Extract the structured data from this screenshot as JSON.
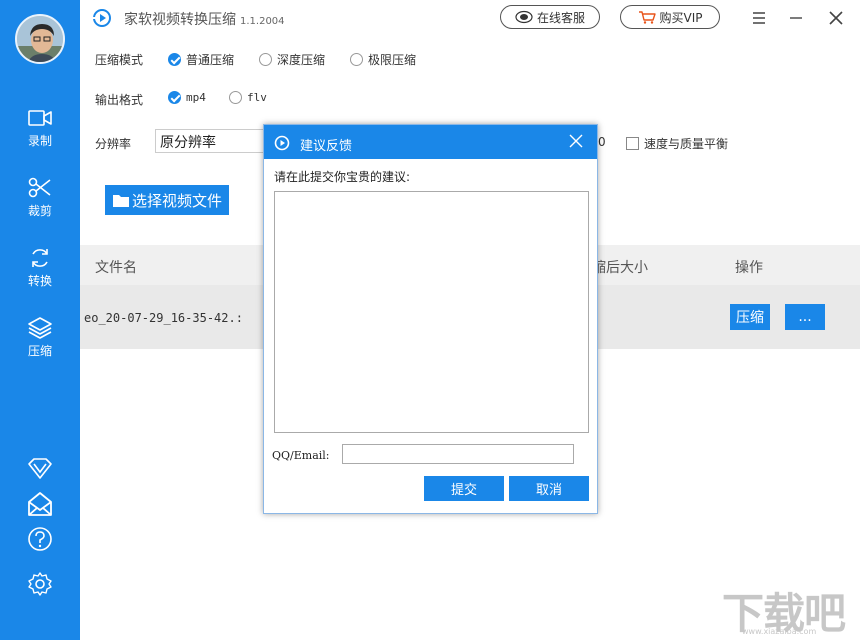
{
  "app": {
    "title": "家软视频转换压缩",
    "version": "1.1.2004"
  },
  "header": {
    "online_service": "在线客服",
    "buy_vip": "购买VIP"
  },
  "sidebar": {
    "items": [
      {
        "label": "录制",
        "icon": "video-camera-icon"
      },
      {
        "label": "裁剪",
        "icon": "scissors-icon"
      },
      {
        "label": "转换",
        "icon": "refresh-icon"
      },
      {
        "label": "压缩",
        "icon": "layers-icon"
      }
    ],
    "bottom_icons": [
      "diamond-icon",
      "mail-icon",
      "help-icon",
      "gear-icon"
    ]
  },
  "settings": {
    "compress_mode_label": "压缩模式",
    "compress_modes": [
      {
        "label": "普通压缩",
        "checked": true
      },
      {
        "label": "深度压缩",
        "checked": false
      },
      {
        "label": "极限压缩",
        "checked": false
      }
    ],
    "output_format_label": "输出格式",
    "output_formats": [
      {
        "label": "mp4",
        "checked": true
      },
      {
        "label": "flv",
        "checked": false
      }
    ],
    "resolution_label": "分辨率",
    "resolution_value": "原分辨率",
    "partial_value": "0",
    "balance_label": "速度与质量平衡",
    "balance_checked": false
  },
  "toolbar": {
    "select_file_label": "选择视频文件"
  },
  "table": {
    "headers": {
      "filename": "文件名",
      "after_size": "缩后大小",
      "action": "操作"
    },
    "rows": [
      {
        "filename": "eo_20-07-29_16-35-42.:",
        "compress_label": "压缩",
        "more_label": "..."
      }
    ]
  },
  "dialog": {
    "title": "建议反馈",
    "prompt": "请在此提交你宝贵的建议:",
    "feedback_value": "",
    "contact_label": "QQ/Email:",
    "contact_value": "",
    "submit_label": "提交",
    "cancel_label": "取消"
  },
  "watermark": {
    "text": "下载吧",
    "sub": "www.xiazaiba.com"
  },
  "colors": {
    "accent": "#1a87e8",
    "sidebar": "#1a87e8",
    "row_bg": "#e9e9e9",
    "header_bg": "#f0f0f0"
  }
}
